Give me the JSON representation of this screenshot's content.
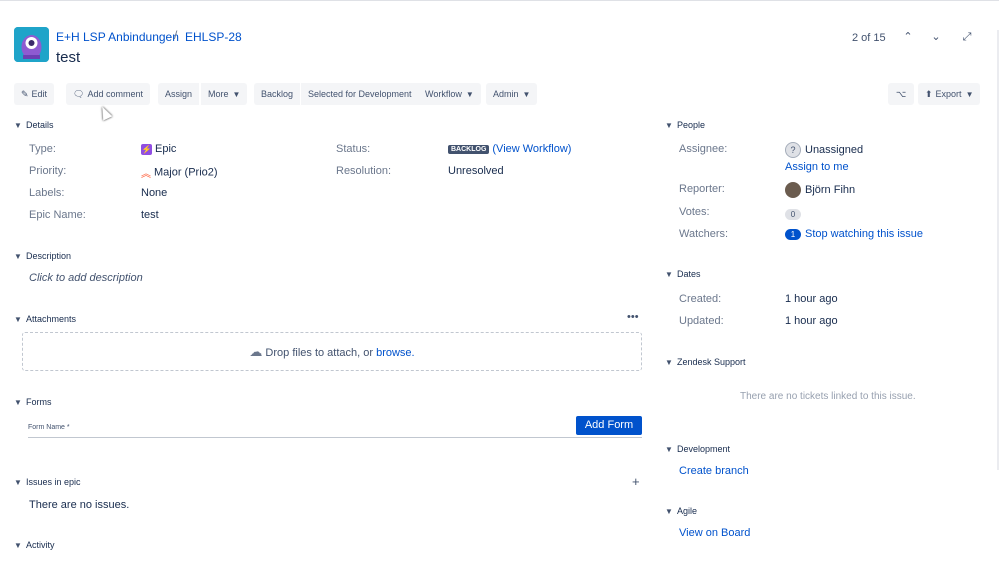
{
  "header": {
    "project": "E+H LSP Anbindungen",
    "separator": "/",
    "issue_key": "EHLSP-28",
    "title": "test",
    "pager": "2 of 15"
  },
  "toolbar": {
    "edit": "Edit",
    "add_comment": "Add comment",
    "assign": "Assign",
    "more": "More",
    "backlog": "Backlog",
    "selected_for_dev": "Selected for Development",
    "workflow": "Workflow",
    "admin": "Admin",
    "export": "Export"
  },
  "details": {
    "heading": "Details",
    "type_label": "Type:",
    "type_value": "Epic",
    "priority_label": "Priority:",
    "priority_value": "Major (Prio2)",
    "labels_label": "Labels:",
    "labels_value": "None",
    "epic_name_label": "Epic Name:",
    "epic_name_value": "test",
    "status_label": "Status:",
    "status_lozenge": "BACKLOG",
    "status_link": "(View Workflow)",
    "resolution_label": "Resolution:",
    "resolution_value": "Unresolved"
  },
  "description": {
    "heading": "Description",
    "placeholder": "Click to add description"
  },
  "attachments": {
    "heading": "Attachments",
    "drop_text": "Drop files to attach, or",
    "browse": "browse."
  },
  "forms": {
    "heading": "Forms",
    "field_label": "Form Name *",
    "add_button": "Add Form"
  },
  "issues_in_epic": {
    "heading": "Issues in epic",
    "empty": "There are no issues."
  },
  "activity": {
    "heading": "Activity"
  },
  "people": {
    "heading": "People",
    "assignee_label": "Assignee:",
    "assignee_value": "Unassigned",
    "assign_to_me": "Assign to me",
    "reporter_label": "Reporter:",
    "reporter_value": "Björn Fihn",
    "votes_label": "Votes:",
    "votes_count": "0",
    "watchers_label": "Watchers:",
    "watchers_count": "1",
    "watch_link": "Stop watching this issue"
  },
  "dates": {
    "heading": "Dates",
    "created_label": "Created:",
    "created_value": "1 hour ago",
    "updated_label": "Updated:",
    "updated_value": "1 hour ago"
  },
  "zendesk": {
    "heading": "Zendesk Support",
    "empty": "There are no tickets linked to this issue."
  },
  "development": {
    "heading": "Development",
    "create_branch": "Create branch"
  },
  "agile": {
    "heading": "Agile",
    "view_on_board": "View on Board"
  },
  "colors": {
    "link": "#0052cc",
    "primary_button": "#0052cc",
    "project_avatar": "#1fa4c9",
    "epic": "#904ee2",
    "priority": "#ff5630"
  }
}
